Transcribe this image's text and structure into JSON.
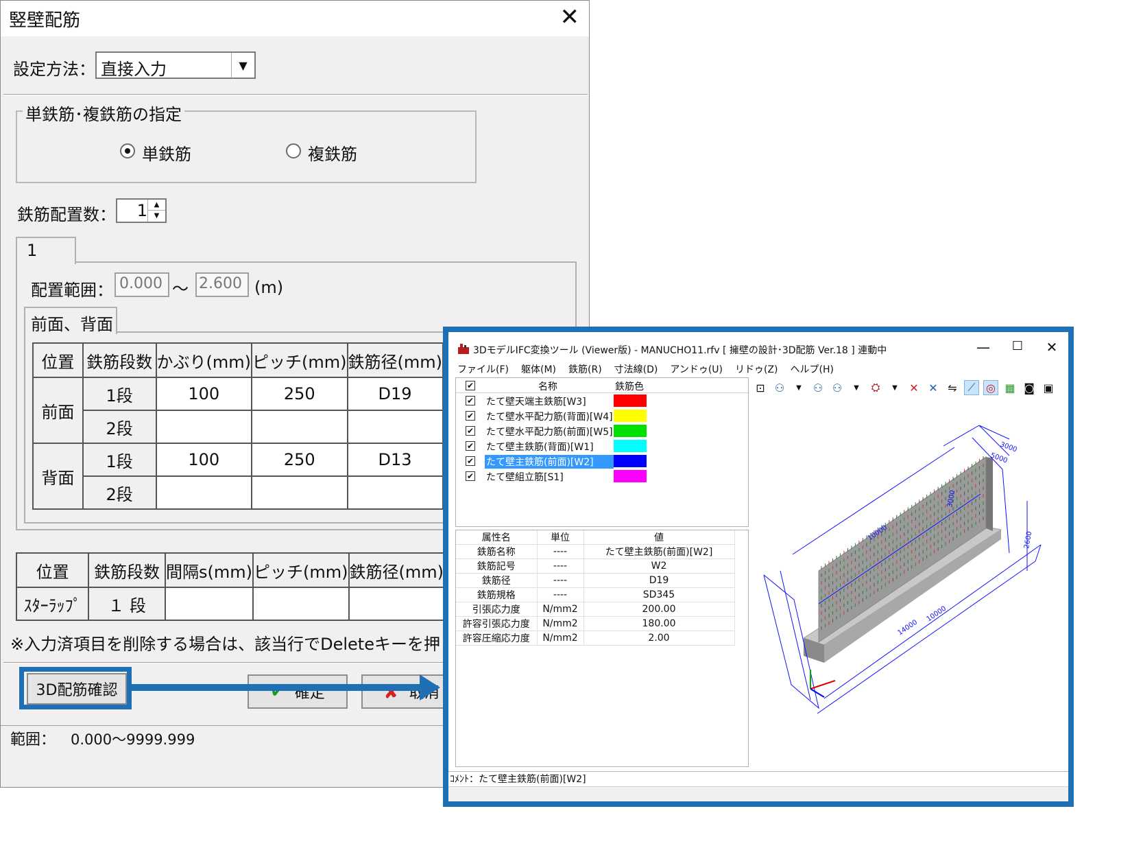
{
  "dialog": {
    "title": "竪壁配筋",
    "close": "✕",
    "method_label": "設定方法：",
    "method_value": "直接入力",
    "group_title": "単鉄筋･複鉄筋の指定",
    "radio_single": "単鉄筋",
    "radio_double": "複鉄筋",
    "count_label": "鉄筋配置数：",
    "count_value": "1",
    "tab_label": "1",
    "range_label": "配置範囲：",
    "range_from": "0.000",
    "range_sep": "～",
    "range_to": "2.600",
    "range_unit": "(m)",
    "subtab_label": "前面、背面",
    "table1": {
      "headers": [
        "位置",
        "鉄筋段数",
        "かぶり(mm)",
        "ピッチ(mm)",
        "鉄筋径(mm)"
      ],
      "front": "前面",
      "back": "背面",
      "rows": [
        {
          "stage": "1段",
          "cover": "100",
          "pitch": "250",
          "dia": "D19"
        },
        {
          "stage": "2段",
          "cover": "",
          "pitch": "",
          "dia": ""
        },
        {
          "stage": "1段",
          "cover": "100",
          "pitch": "250",
          "dia": "D13"
        },
        {
          "stage": "2段",
          "cover": "",
          "pitch": "",
          "dia": ""
        }
      ]
    },
    "table2": {
      "headers": [
        "位置",
        "鉄筋段数",
        "間隔s(mm)",
        "ピッチ(mm)",
        "鉄筋径(mm)"
      ],
      "row": {
        "pos": "ｽﾀｰﾗｯﾌﾟ",
        "stage": "１ 段",
        "gap": "",
        "pitch": "",
        "dia": ""
      }
    },
    "note": "※入力済項目を削除する場合は、該当行でDeleteキーを押してください。",
    "btn_3d": "3D配筋確認",
    "btn_ok": "確定",
    "btn_cancel": "取消",
    "status_label": "範囲：",
    "status_value": "0.000～9999.999"
  },
  "viewer": {
    "title": "3DモデルIFC変換ツール (Viewer版) - MANUCHO11.rfv [ 擁壁の設計･3D配筋 Ver.18 ] 連動中",
    "menu": [
      "ファイル(F)",
      "躯体(M)",
      "鉄筋(R)",
      "寸法線(D)",
      "アンドゥ(U)",
      "リドゥ(Z)",
      "ヘルプ(H)"
    ],
    "layer_headers": {
      "name": "名称",
      "color": "鉄筋色"
    },
    "layers": [
      {
        "name": "たて壁天端主鉄筋[W3]",
        "color": "#ff0000"
      },
      {
        "name": "たて壁水平配力筋(背面)[W4]",
        "color": "#ffff00"
      },
      {
        "name": "たて壁水平配力筋(前面)[W5]",
        "color": "#00e000"
      },
      {
        "name": "たて壁主鉄筋(背面)[W1]",
        "color": "#00ffff"
      },
      {
        "name": "たて壁主鉄筋(前面)[W2]",
        "color": "#0000ff"
      },
      {
        "name": "たて壁組立筋[S1]",
        "color": "#ff00ff"
      }
    ],
    "prop_headers": [
      "属性名",
      "単位",
      "値"
    ],
    "props": [
      [
        "鉄筋名称",
        "----",
        "たて壁主鉄筋(前面)[W2]"
      ],
      [
        "鉄筋記号",
        "----",
        "W2"
      ],
      [
        "鉄筋径",
        "----",
        "D19"
      ],
      [
        "鉄筋規格",
        "----",
        "SD345"
      ],
      [
        "引張応力度",
        "N/mm2",
        "200.00"
      ],
      [
        "許容引張応力度",
        "N/mm2",
        "180.00"
      ],
      [
        "許容圧縮応力度",
        "N/mm2",
        "2.00"
      ]
    ],
    "comment": "ｺﾒﾝﾄ：たて壁主鉄筋(前面)[W2]",
    "dim_labels": [
      "10000",
      "3000",
      "5000",
      "10000",
      "14000",
      "2600",
      "3000"
    ],
    "highlight_color": "#1f6fb5"
  }
}
